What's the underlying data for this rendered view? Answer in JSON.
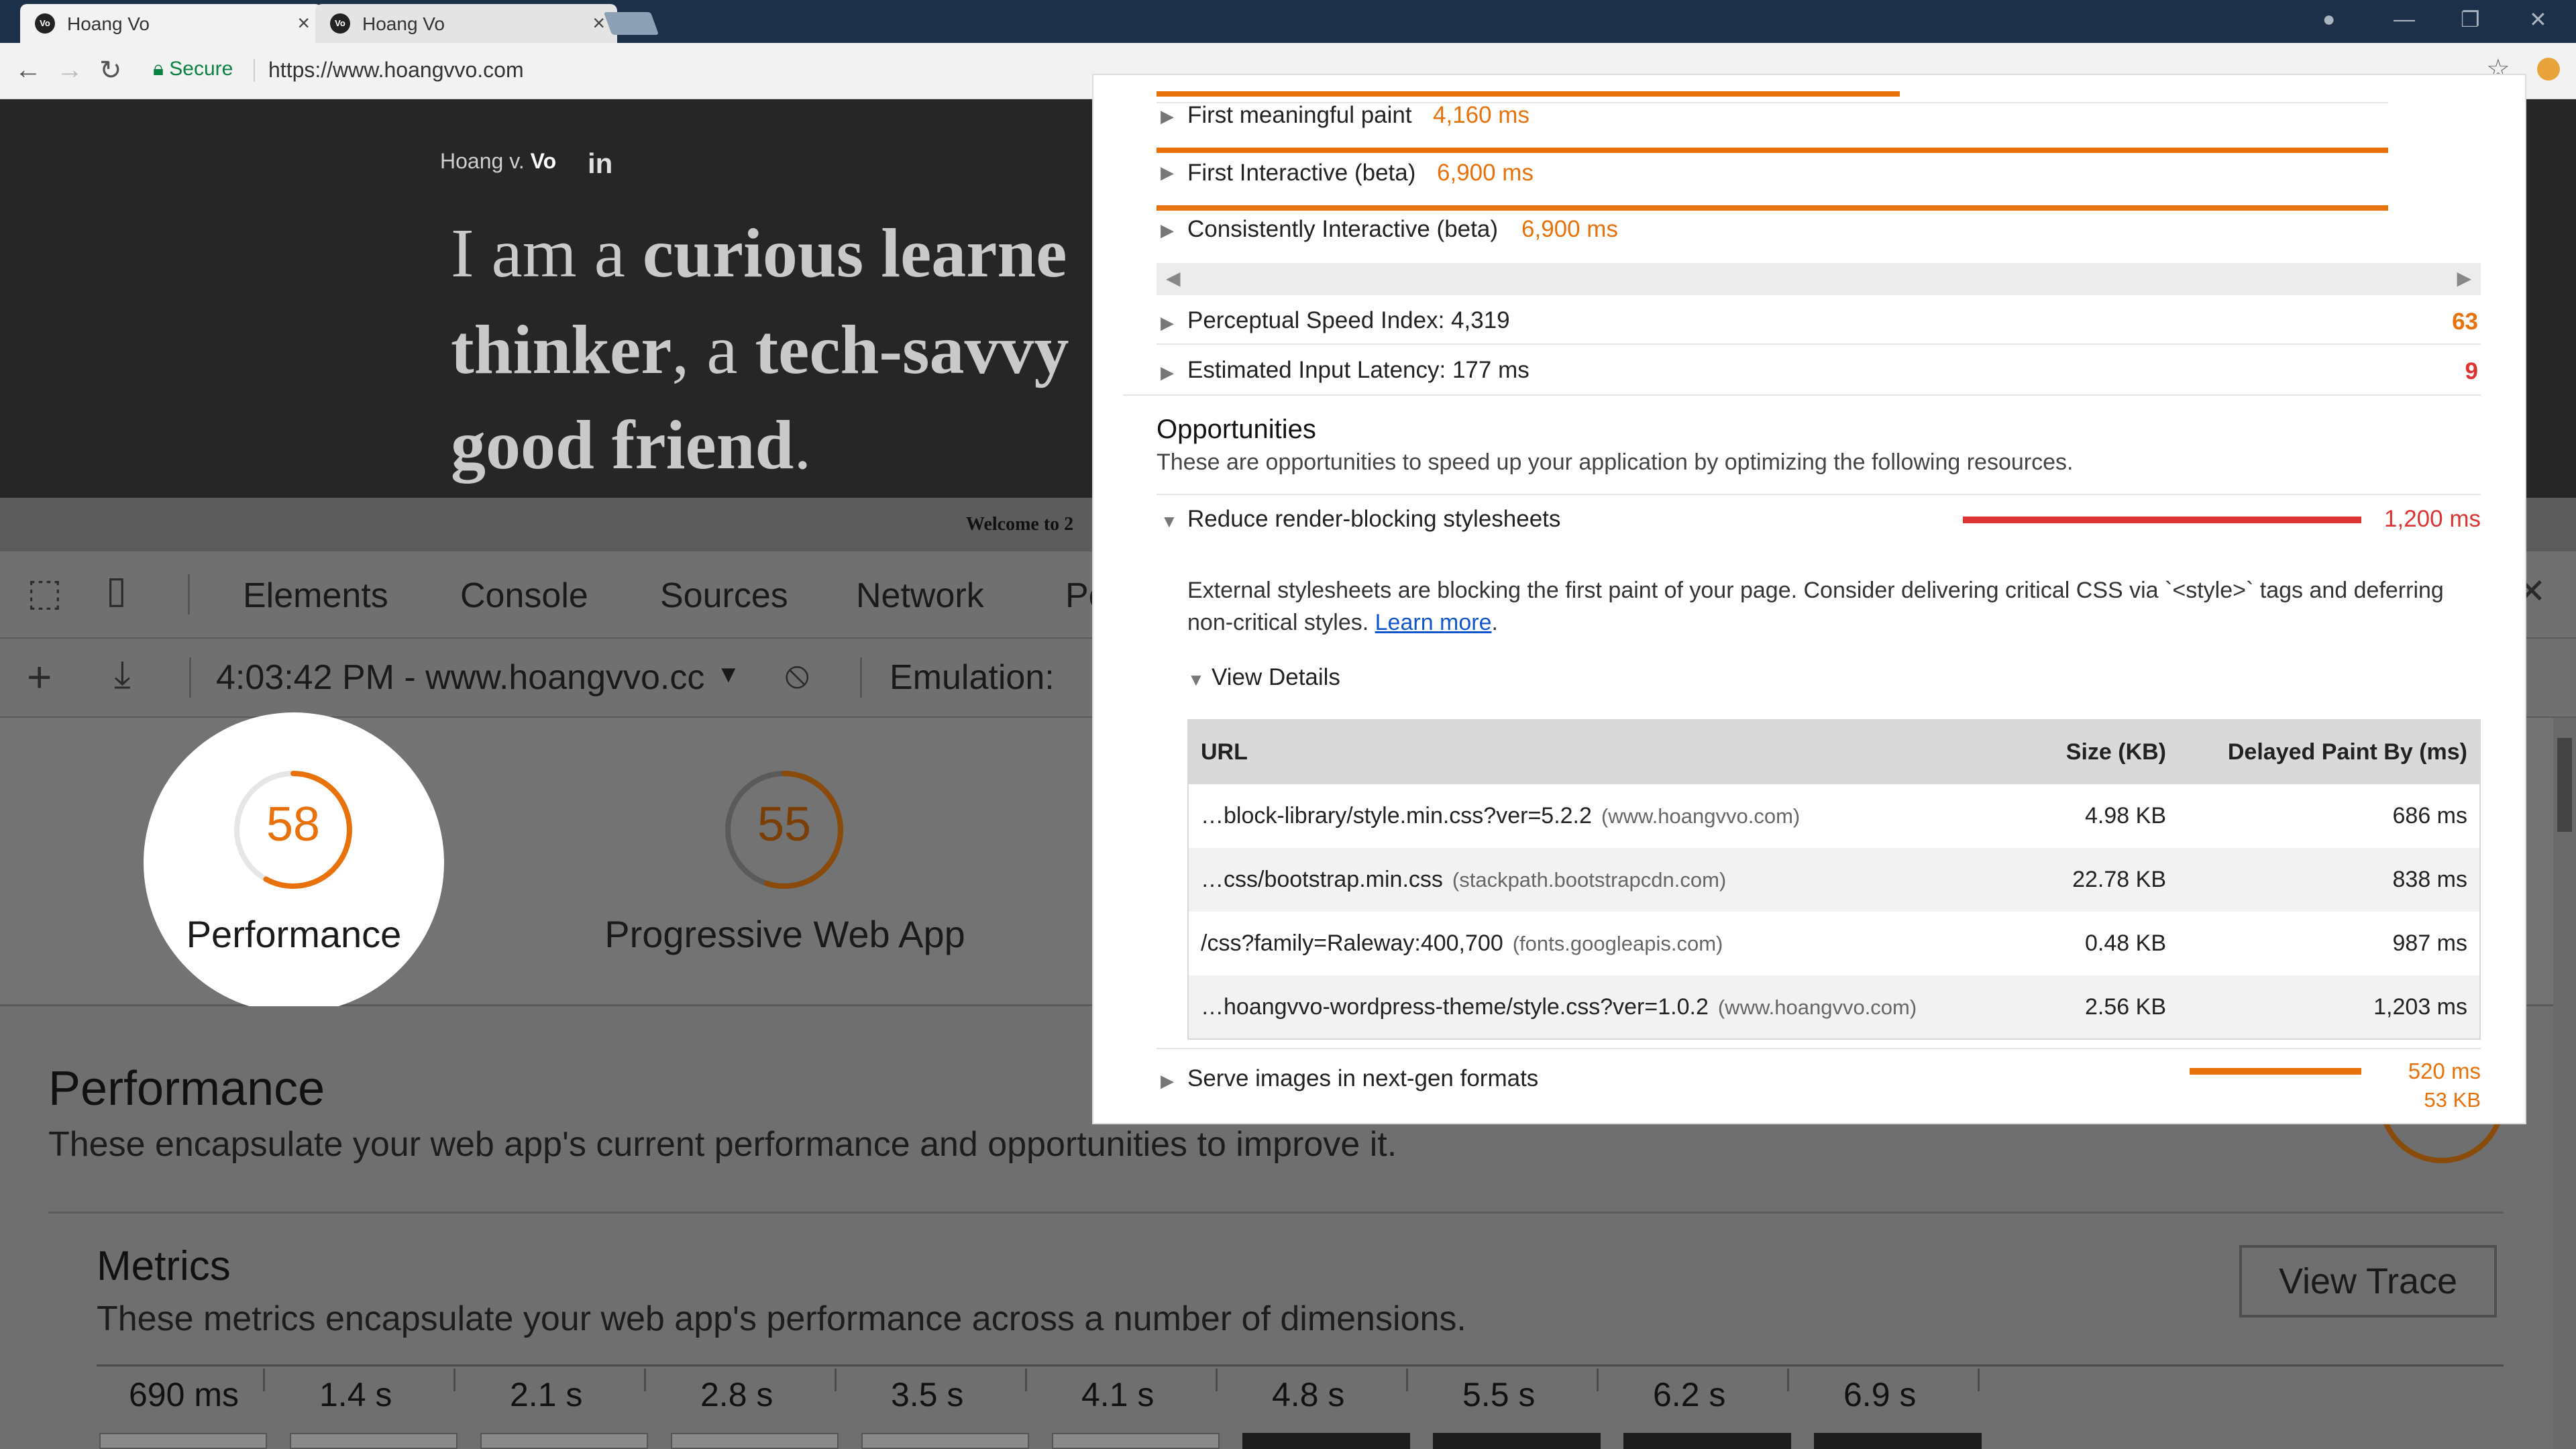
{
  "browser": {
    "tabs": [
      {
        "title": "Hoang Vo"
      },
      {
        "title": "Hoang Vo"
      }
    ],
    "secure_label": "Secure",
    "url": "https://www.hoangvvo.com"
  },
  "site": {
    "logo_light": "Hoang v.",
    "logo_bold": "Vo",
    "linkedin": "in",
    "hero_lines": [
      {
        "pre": "I am a ",
        "bold": "curious learne",
        "post": ""
      },
      {
        "pre": "",
        "bold": "thinker",
        "post": ", a "
      },
      {
        "pre": "",
        "bold": "good friend",
        "post": "."
      }
    ],
    "hero_line2_bold2": "tech-savvy",
    "welcome": "Welcome to 2"
  },
  "devtools": {
    "tabs": [
      "Elements",
      "Console",
      "Sources",
      "Network",
      "Pe"
    ],
    "report_label": "4:03:42 PM - www.hoangvvo.cc",
    "emulation_label": "Emulation:",
    "scores": [
      {
        "value": "58",
        "label": "Performance"
      },
      {
        "value": "55",
        "label": "Progressive Web App"
      }
    ],
    "performance": {
      "title": "Performance",
      "description": "These encapsulate your web app's current performance and opportunities to improve it."
    },
    "metrics": {
      "title": "Metrics",
      "description": "These metrics encapsulate your web app's performance across a number of dimensions.",
      "view_trace": "View Trace",
      "timeline": [
        "690 ms",
        "1.4 s",
        "2.1 s",
        "2.8 s",
        "3.5 s",
        "4.1 s",
        "4.8 s",
        "5.5 s",
        "6.2 s",
        "6.9 s"
      ]
    }
  },
  "popup": {
    "metrics": [
      {
        "label": "First meaningful paint",
        "value": "4,160 ms"
      },
      {
        "label": "First Interactive (beta)",
        "value": "6,900 ms"
      },
      {
        "label": "Consistently Interactive (beta)",
        "value": "6,900 ms"
      }
    ],
    "speed_index": {
      "label": "Perceptual Speed Index: 4,319",
      "score": "63"
    },
    "input_latency": {
      "label": "Estimated Input Latency: 177 ms",
      "score": "9"
    },
    "opportunities": {
      "title": "Opportunities",
      "description": "These are opportunities to speed up your application by optimizing the following resources."
    },
    "render_blocking": {
      "label": "Reduce render-blocking stylesheets",
      "value": "1,200 ms",
      "desc_part1": "External stylesheets are blocking the first paint of your page. Consider delivering critical CSS via `<style>` tags and deferring non-critical styles. ",
      "learn_more": "Learn more",
      "desc_end": ".",
      "view_details": "View Details"
    },
    "table": {
      "headers": [
        "URL",
        "Size (KB)",
        "Delayed Paint By (ms)"
      ],
      "rows": [
        {
          "url": "…block-library/style.min.css?ver=5.2.2",
          "domain": "(www.hoangvvo.com)",
          "size": "4.98 KB",
          "delay": "686 ms"
        },
        {
          "url": "…css/bootstrap.min.css",
          "domain": "(stackpath.bootstrapcdn.com)",
          "size": "22.78 KB",
          "delay": "838 ms"
        },
        {
          "url": "/css?family=Raleway:400,700",
          "domain": "(fonts.googleapis.com)",
          "size": "0.48 KB",
          "delay": "987 ms"
        },
        {
          "url": "…hoangvvo-wordpress-theme/style.css?ver=1.0.2",
          "domain": "(www.hoangvvo.com)",
          "size": "2.56 KB",
          "delay": "1,203 ms"
        }
      ]
    },
    "next_gen": {
      "label": "Serve images in next-gen formats",
      "value": "520 ms",
      "size": "53 KB"
    }
  },
  "colors": {
    "accent_orange": "#e8710a",
    "fail_red": "#d33333",
    "chrome_titlebar": "#1d3049"
  }
}
